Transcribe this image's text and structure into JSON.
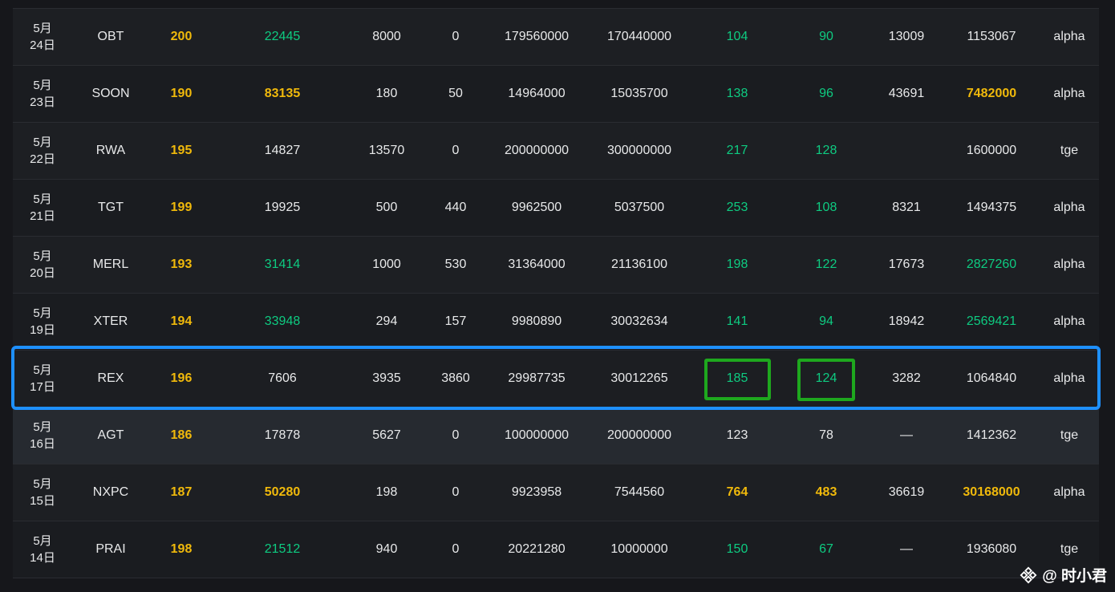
{
  "rows": [
    {
      "date_m": "5月",
      "date_d": "24日",
      "token": "OBT",
      "score": "200",
      "users": "22445",
      "a": "8000",
      "b": "0",
      "c": "179560000",
      "d": "170440000",
      "e": "104",
      "f": "90",
      "g": "13009",
      "h": "1153067",
      "type": "alpha"
    },
    {
      "date_m": "5月",
      "date_d": "23日",
      "token": "SOON",
      "score": "190",
      "users": "83135",
      "a": "180",
      "b": "50",
      "c": "14964000",
      "d": "15035700",
      "e": "138",
      "f": "96",
      "g": "43691",
      "h": "7482000",
      "type": "alpha"
    },
    {
      "date_m": "5月",
      "date_d": "22日",
      "token": "RWA",
      "score": "195",
      "users": "14827",
      "a": "13570",
      "b": "0",
      "c": "200000000",
      "d": "300000000",
      "e": "217",
      "f": "128",
      "g": "",
      "h": "1600000",
      "type": "tge"
    },
    {
      "date_m": "5月",
      "date_d": "21日",
      "token": "TGT",
      "score": "199",
      "users": "19925",
      "a": "500",
      "b": "440",
      "c": "9962500",
      "d": "5037500",
      "e": "253",
      "f": "108",
      "g": "8321",
      "h": "1494375",
      "type": "alpha"
    },
    {
      "date_m": "5月",
      "date_d": "20日",
      "token": "MERL",
      "score": "193",
      "users": "31414",
      "a": "1000",
      "b": "530",
      "c": "31364000",
      "d": "21136100",
      "e": "198",
      "f": "122",
      "g": "17673",
      "h": "2827260",
      "type": "alpha"
    },
    {
      "date_m": "5月",
      "date_d": "19日",
      "token": "XTER",
      "score": "194",
      "users": "33948",
      "a": "294",
      "b": "157",
      "c": "9980890",
      "d": "30032634",
      "e": "141",
      "f": "94",
      "g": "18942",
      "h": "2569421",
      "type": "alpha"
    },
    {
      "date_m": "5月",
      "date_d": "17日",
      "token": "REX",
      "score": "196",
      "users": "7606",
      "a": "3935",
      "b": "3860",
      "c": "29987735",
      "d": "30012265",
      "e": "185",
      "f": "124",
      "g": "3282",
      "h": "1064840",
      "type": "alpha"
    },
    {
      "date_m": "5月",
      "date_d": "16日",
      "token": "AGT",
      "score": "186",
      "users": "17878",
      "a": "5627",
      "b": "0",
      "c": "100000000",
      "d": "200000000",
      "e": "123",
      "f": "78",
      "g": "—",
      "h": "1412362",
      "type": "tge"
    },
    {
      "date_m": "5月",
      "date_d": "15日",
      "token": "NXPC",
      "score": "187",
      "users": "50280",
      "a": "198",
      "b": "0",
      "c": "9923958",
      "d": "7544560",
      "e": "764",
      "f": "483",
      "g": "36619",
      "h": "30168000",
      "type": "alpha"
    },
    {
      "date_m": "5月",
      "date_d": "14日",
      "token": "PRAI",
      "score": "198",
      "users": "21512",
      "a": "940",
      "b": "0",
      "c": "20221280",
      "d": "10000000",
      "e": "150",
      "f": "67",
      "g": "—",
      "h": "1936080",
      "type": "tge"
    }
  ],
  "colors": {
    "yellow": "#f0b90b",
    "green": "#0ecb81",
    "highlight_blue": "#1e90ff",
    "highlight_green": "#1ea81e"
  },
  "credit": {
    "text": "@ 时小君",
    "icon": "binance-logo-icon"
  }
}
